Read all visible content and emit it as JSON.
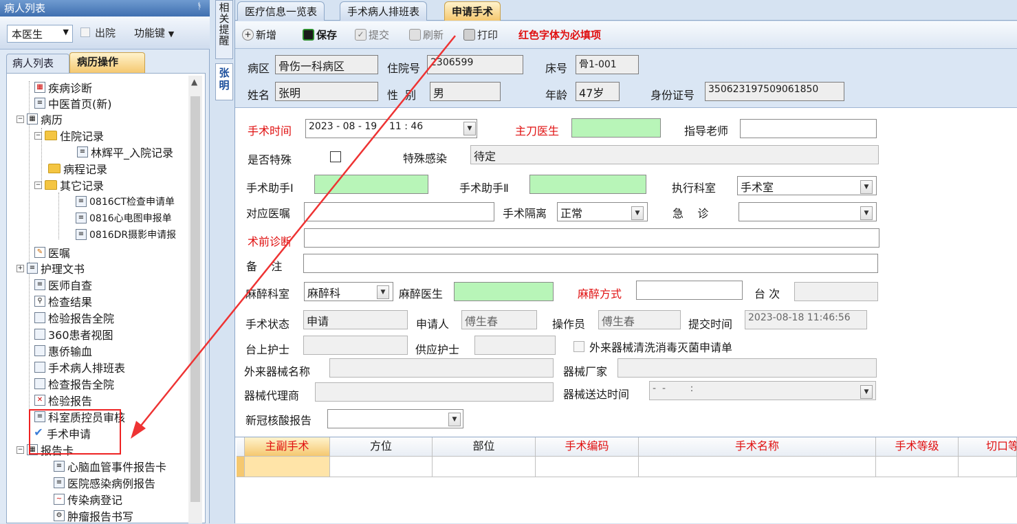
{
  "left_panel": {
    "title": "病人列表",
    "doctor_select": "本医生",
    "discharge_label": "出院",
    "function_key_label": "功能键",
    "tabs": [
      "病人列表",
      "病历操作"
    ],
    "tree": [
      "疾病诊断",
      "中医首页(新)",
      "病历",
      "住院记录",
      "林辉平_入院记录",
      "病程记录",
      "其它记录",
      "0816CT检查申请单",
      "0816心电图申报单",
      "0816DR摄影申请报",
      "医嘱",
      "护理文书",
      "医师自查",
      "检查结果",
      "检验报告全院",
      "360患者视图",
      "惠侨输血",
      "手术病人排班表",
      "检查报告全院",
      "检验报告",
      "科室质控员审核",
      "手术申请",
      "报告卡",
      "心脑血管事件报告卡",
      "医院感染病例报告",
      "传染病登记",
      "肿瘤报告书写"
    ]
  },
  "side_strip": {
    "reminder": "相关提醒",
    "patient_tab": "张明"
  },
  "tabs": [
    "医疗信息一览表",
    "手术病人排班表",
    "申请手术"
  ],
  "toolbar": {
    "new": "新增",
    "save": "保存",
    "submit": "提交",
    "refresh": "刷新",
    "print": "打印",
    "notice": "红色字体为必填项"
  },
  "patient": {
    "ward_label": "病区",
    "ward": "骨伤一科病区",
    "admission_label": "住院号",
    "admission_no": "2306599",
    "bed_label": "床号",
    "bed": "骨1-001",
    "name_label": "姓名",
    "name": "张明",
    "sex_label": "性  别",
    "sex": "男",
    "age_label": "年龄",
    "age": "47岁",
    "id_label": "身份证号",
    "id_no": "350623197509061850"
  },
  "form": {
    "surgery_time_label": "手术时间",
    "surgery_time": "2023 - 08 - 19    11 : 46",
    "chief_surgeon_label": "主刀医生",
    "instructor_label": "指导老师",
    "special_label": "是否特殊",
    "infection_label": "特殊感染",
    "infection": "待定",
    "assistant1_label": "手术助手Ⅰ",
    "assistant2_label": "手术助手Ⅱ",
    "exec_dept_label": "执行科室",
    "exec_dept": "手术室",
    "order_label": "对应医嘱",
    "isolation_label": "手术隔离",
    "isolation": "正常",
    "emergency_label": "急    诊",
    "preop_diag_label": "术前诊断",
    "remark_label": "备    注",
    "anes_dept_label": "麻醉科室",
    "anes_dept": "麻醉科",
    "anes_doctor_label": "麻醉医生",
    "anes_method_label": "麻醉方式",
    "table_no_label": "台 次",
    "status_label": "手术状态",
    "status": "申请",
    "applicant_label": "申请人",
    "applicant": "傅生春",
    "operator_label": "操作员",
    "operator": "傅生春",
    "submit_time_label": "提交时间",
    "submit_time": "2023-08-18 11:46:56",
    "scrub_nurse_label": "台上护士",
    "supply_nurse_label": "供应护士",
    "external_clean_label": "外来器械清洗消毒灭菌申请单",
    "external_name_label": "外来器械名称",
    "manufacturer_label": "器械厂家",
    "agent_label": "器械代理商",
    "delivery_time_label": "器械送达时间",
    "delivery_time": "-  -        :",
    "covid_label": "新冠核酸报告"
  },
  "grid": {
    "columns": [
      "主副手术",
      "方位",
      "部位",
      "手术编码",
      "手术名称",
      "手术等级",
      "切口等"
    ]
  },
  "colors": {
    "required": "#e01010",
    "green_field": "#b8f5b8",
    "active_tab": "#f5c870"
  }
}
